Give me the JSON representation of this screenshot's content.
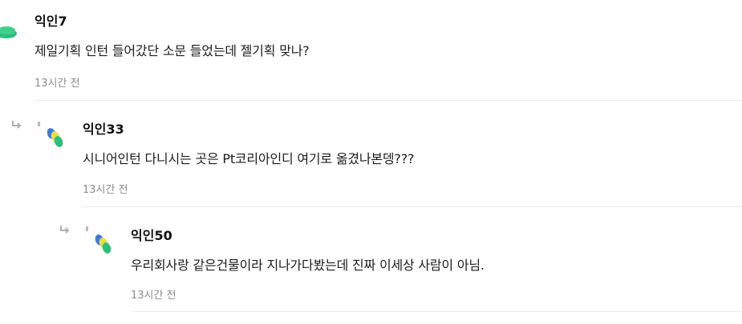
{
  "comments": [
    {
      "author": "익인7",
      "text": "제일기획 인턴 들어갔단 소문 들었는데 젤기획 맞나?",
      "time": "13시간 전"
    },
    {
      "author": "익인33",
      "text": "시니어인턴 다니시는 곳은 Pt코리아인디 여기로 옮겼나본뎅???",
      "time": "13시간 전"
    },
    {
      "author": "익인50",
      "text": "우리회사랑 같은건물이라 지나가다봤는데 진짜 이세상 사람이 아님.",
      "time": "13시간 전"
    }
  ],
  "colors": {
    "avatar_green": "#2bbf7a",
    "avatar_blue": "#3a7be0",
    "avatar_yellow": "#e8de4a",
    "divider": "#e9e9e9",
    "time_text": "#8c8c8c"
  },
  "icons": {
    "reply": "reply-arrow-icon",
    "avatar": "avatar-blob-icon"
  }
}
